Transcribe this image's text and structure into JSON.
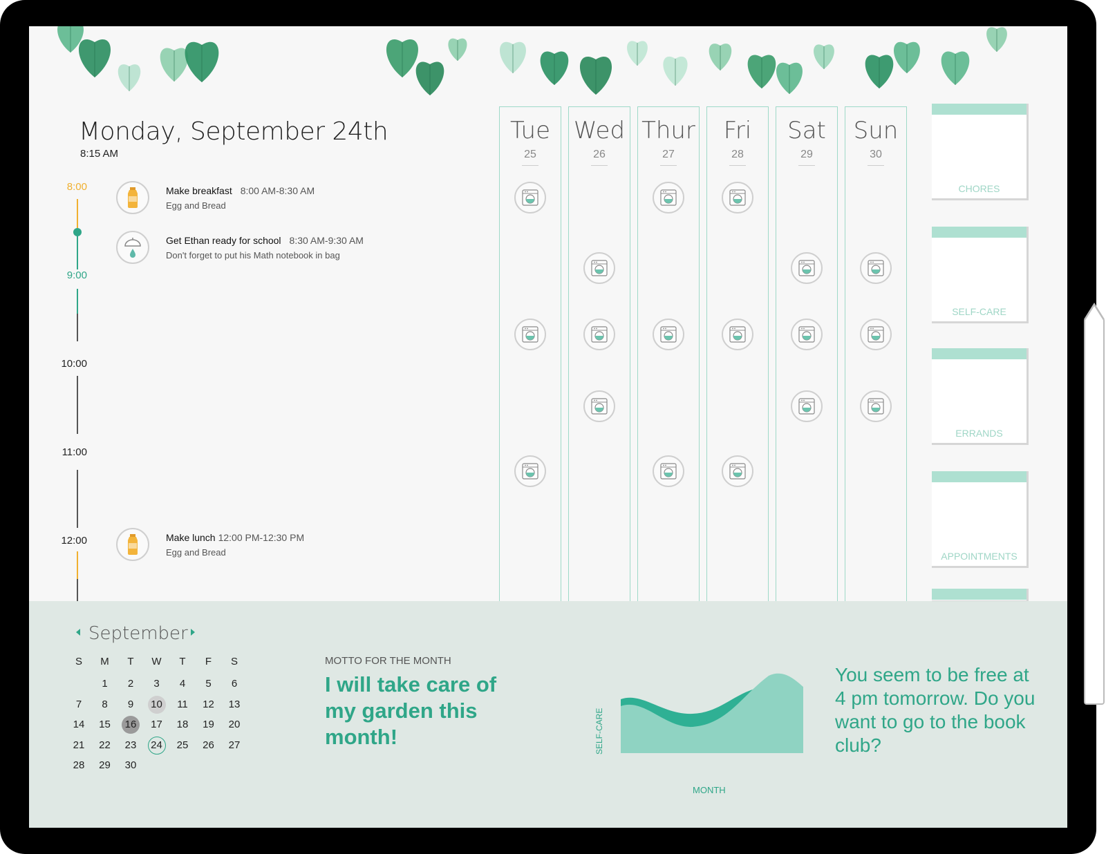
{
  "header": {
    "date": "Monday, September 24th",
    "current_time": "8:15 AM"
  },
  "timeline": {
    "hours": [
      "8:00",
      "9:00",
      "10:00",
      "11:00",
      "12:00"
    ],
    "colors": {
      "past": "#f0b02f",
      "current": "#2fa688",
      "future": "#222222"
    }
  },
  "tasks": [
    {
      "icon": "juice-bottle-icon",
      "title": "Make breakfast",
      "time": "8:00 AM-8:30 AM",
      "note": "Egg and Bread"
    },
    {
      "icon": "shower-icon",
      "title": "Get Ethan ready for school",
      "time": "8:30 AM-9:30 AM",
      "note": "Don't forget to put his Math notebook in bag"
    },
    {
      "icon": "juice-bottle-icon",
      "title": "Make lunch",
      "time": "12:00 PM-12:30 PM",
      "note": "Egg and Bread"
    }
  ],
  "week": [
    {
      "name": "Tue",
      "num": "25"
    },
    {
      "name": "Wed",
      "num": "26"
    },
    {
      "name": "Thur",
      "num": "27"
    },
    {
      "name": "Fri",
      "num": "28"
    },
    {
      "name": "Sat",
      "num": "29"
    },
    {
      "name": "Sun",
      "num": "30"
    }
  ],
  "categories": [
    "CHORES",
    "SELF-CARE",
    "ERRANDS",
    "APPOINTMENTS"
  ],
  "calendar": {
    "month": "September",
    "weekdays": [
      "S",
      "M",
      "T",
      "W",
      "T",
      "F",
      "S"
    ],
    "days": [
      "",
      "1",
      "2",
      "3",
      "4",
      "5",
      "6",
      "7",
      "8",
      "9",
      "10",
      "11",
      "12",
      "13",
      "14",
      "15",
      "16",
      "17",
      "18",
      "19",
      "20",
      "21",
      "22",
      "23",
      "24",
      "25",
      "26",
      "27",
      "28",
      "29",
      "30"
    ],
    "marked_light": "10",
    "marked_dark": "16",
    "today": "24"
  },
  "motto": {
    "label": "MOTTO FOR THE MONTH",
    "text": "I will take care of my garden this month!"
  },
  "chart": {
    "ylabel": "SELF-CARE",
    "xlabel": "MONTH",
    "colors": {
      "light": "#8fd3c2",
      "dark": "#2fb094"
    }
  },
  "suggestion": "You seem to be free at 4 pm tomorrow. Do you want to go to the  book club?",
  "colors": {
    "accent": "#2fa688",
    "card_band": "#aee0d1",
    "column_border": "#9ed9c8",
    "footer": "#dfe8e4"
  }
}
